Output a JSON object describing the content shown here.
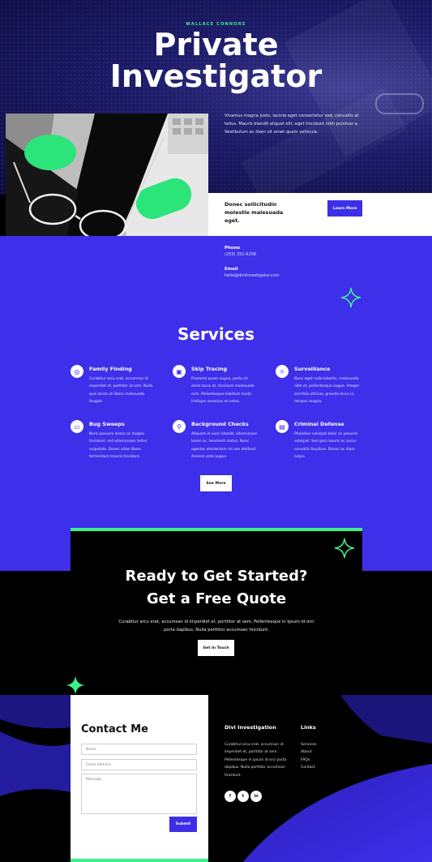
{
  "hero": {
    "eyebrow": "WALLACE CONNORS",
    "title_line1": "Private",
    "title_line2": "Investigator",
    "text": "Vivamus magna justo, lacinia eget consectetur sed, convallis at tellus. Mauris blandit aliquet elit, eget tincidunt nibh pulvinar a. Vestibulum ac diam sit amet quam vehicula."
  },
  "cta_strip": {
    "text": "Donec sollicitudin molestie malesuada eget.",
    "button": "Learn More"
  },
  "contact_info": {
    "phone_label": "Phone",
    "phone": "(255) 352-6258",
    "email_label": "Email",
    "email": "hello@diviinvestigator.com"
  },
  "services": {
    "title": "Services",
    "items": [
      {
        "icon": "compass-icon",
        "glyph": "◎",
        "title": "Family Finding",
        "text": "Curabitur arcu erat, accumsan id imperdiet et, porttitor at sem. Nulla quis lorem ut libero malesuada feugiat."
      },
      {
        "icon": "image-icon",
        "glyph": "▣",
        "title": "Skip Tracing",
        "text": "Praesent quam augue, porta sit amet lacus et, tincidunt malesuada sem. Pellentesque habitant morbi tristique senectus et netus."
      },
      {
        "icon": "lightbulb-icon",
        "glyph": "☼",
        "title": "Surveillance",
        "text": "Nunc eget nulla lobortis, malesuada nibh et, pellentesque augue. Integer sed felis ultrices, gravida lacus in, tempus magna."
      },
      {
        "icon": "monitor-icon",
        "glyph": "▭",
        "title": "Bug Sweeps",
        "text": "Nunc posuere lectus ac magna tincidunt, sed ullamcorper tellus vulputate. Donec vitae libero fermentum mauris tincidunt."
      },
      {
        "icon": "pin-icon",
        "glyph": "⚲",
        "title": "Background Checks",
        "text": "Aliquam id nunc blandit, ullamcorper lorem ac, hendrerit metus. Nunc egestas elementum mi non eleifend. Aenean ante augue."
      },
      {
        "icon": "film-icon",
        "glyph": "▤",
        "title": "Criminal Defense",
        "text": "Phasellus volutpat dolor ac posuere volutpat. Sed quis mauris ac purus convallis faucibus. Donec ac diam turpis."
      }
    ],
    "button": "See More"
  },
  "quote": {
    "title_line1": "Ready to Get Started?",
    "title_line2": "Get a Free Quote",
    "text": "Curabitur arcu erat, accumsan id imperdiet et, porttitor at sem. Pellentesque in ipsum id orci porta dapibus. Nulla porttitor accumsan tincidunt.",
    "button": "Get In Touch"
  },
  "contact_form": {
    "title": "Contact Me",
    "name_placeholder": "Name",
    "email_placeholder": "Email Address",
    "message_placeholder": "Message",
    "submit": "Submit"
  },
  "footer": {
    "about_title": "Divi Investigation",
    "about_text": "Curabitur arcu erat, accumsan id imperdiet et, porttitor at sem. Pellentesque in ipsum id orci porta dapibus. Nulla porttitor accumsan tincidunt.",
    "links_title": "Links",
    "links": [
      "Services",
      "About",
      "FAQs",
      "Contact"
    ],
    "social": [
      {
        "icon": "facebook-icon",
        "glyph": "f"
      },
      {
        "icon": "twitter-icon",
        "glyph": "t"
      },
      {
        "icon": "linkedin-icon",
        "glyph": "in"
      }
    ]
  },
  "colors": {
    "accent_blue": "#3e2fea",
    "accent_green": "#3cf08a",
    "hero_navy": "#0e0c42"
  }
}
